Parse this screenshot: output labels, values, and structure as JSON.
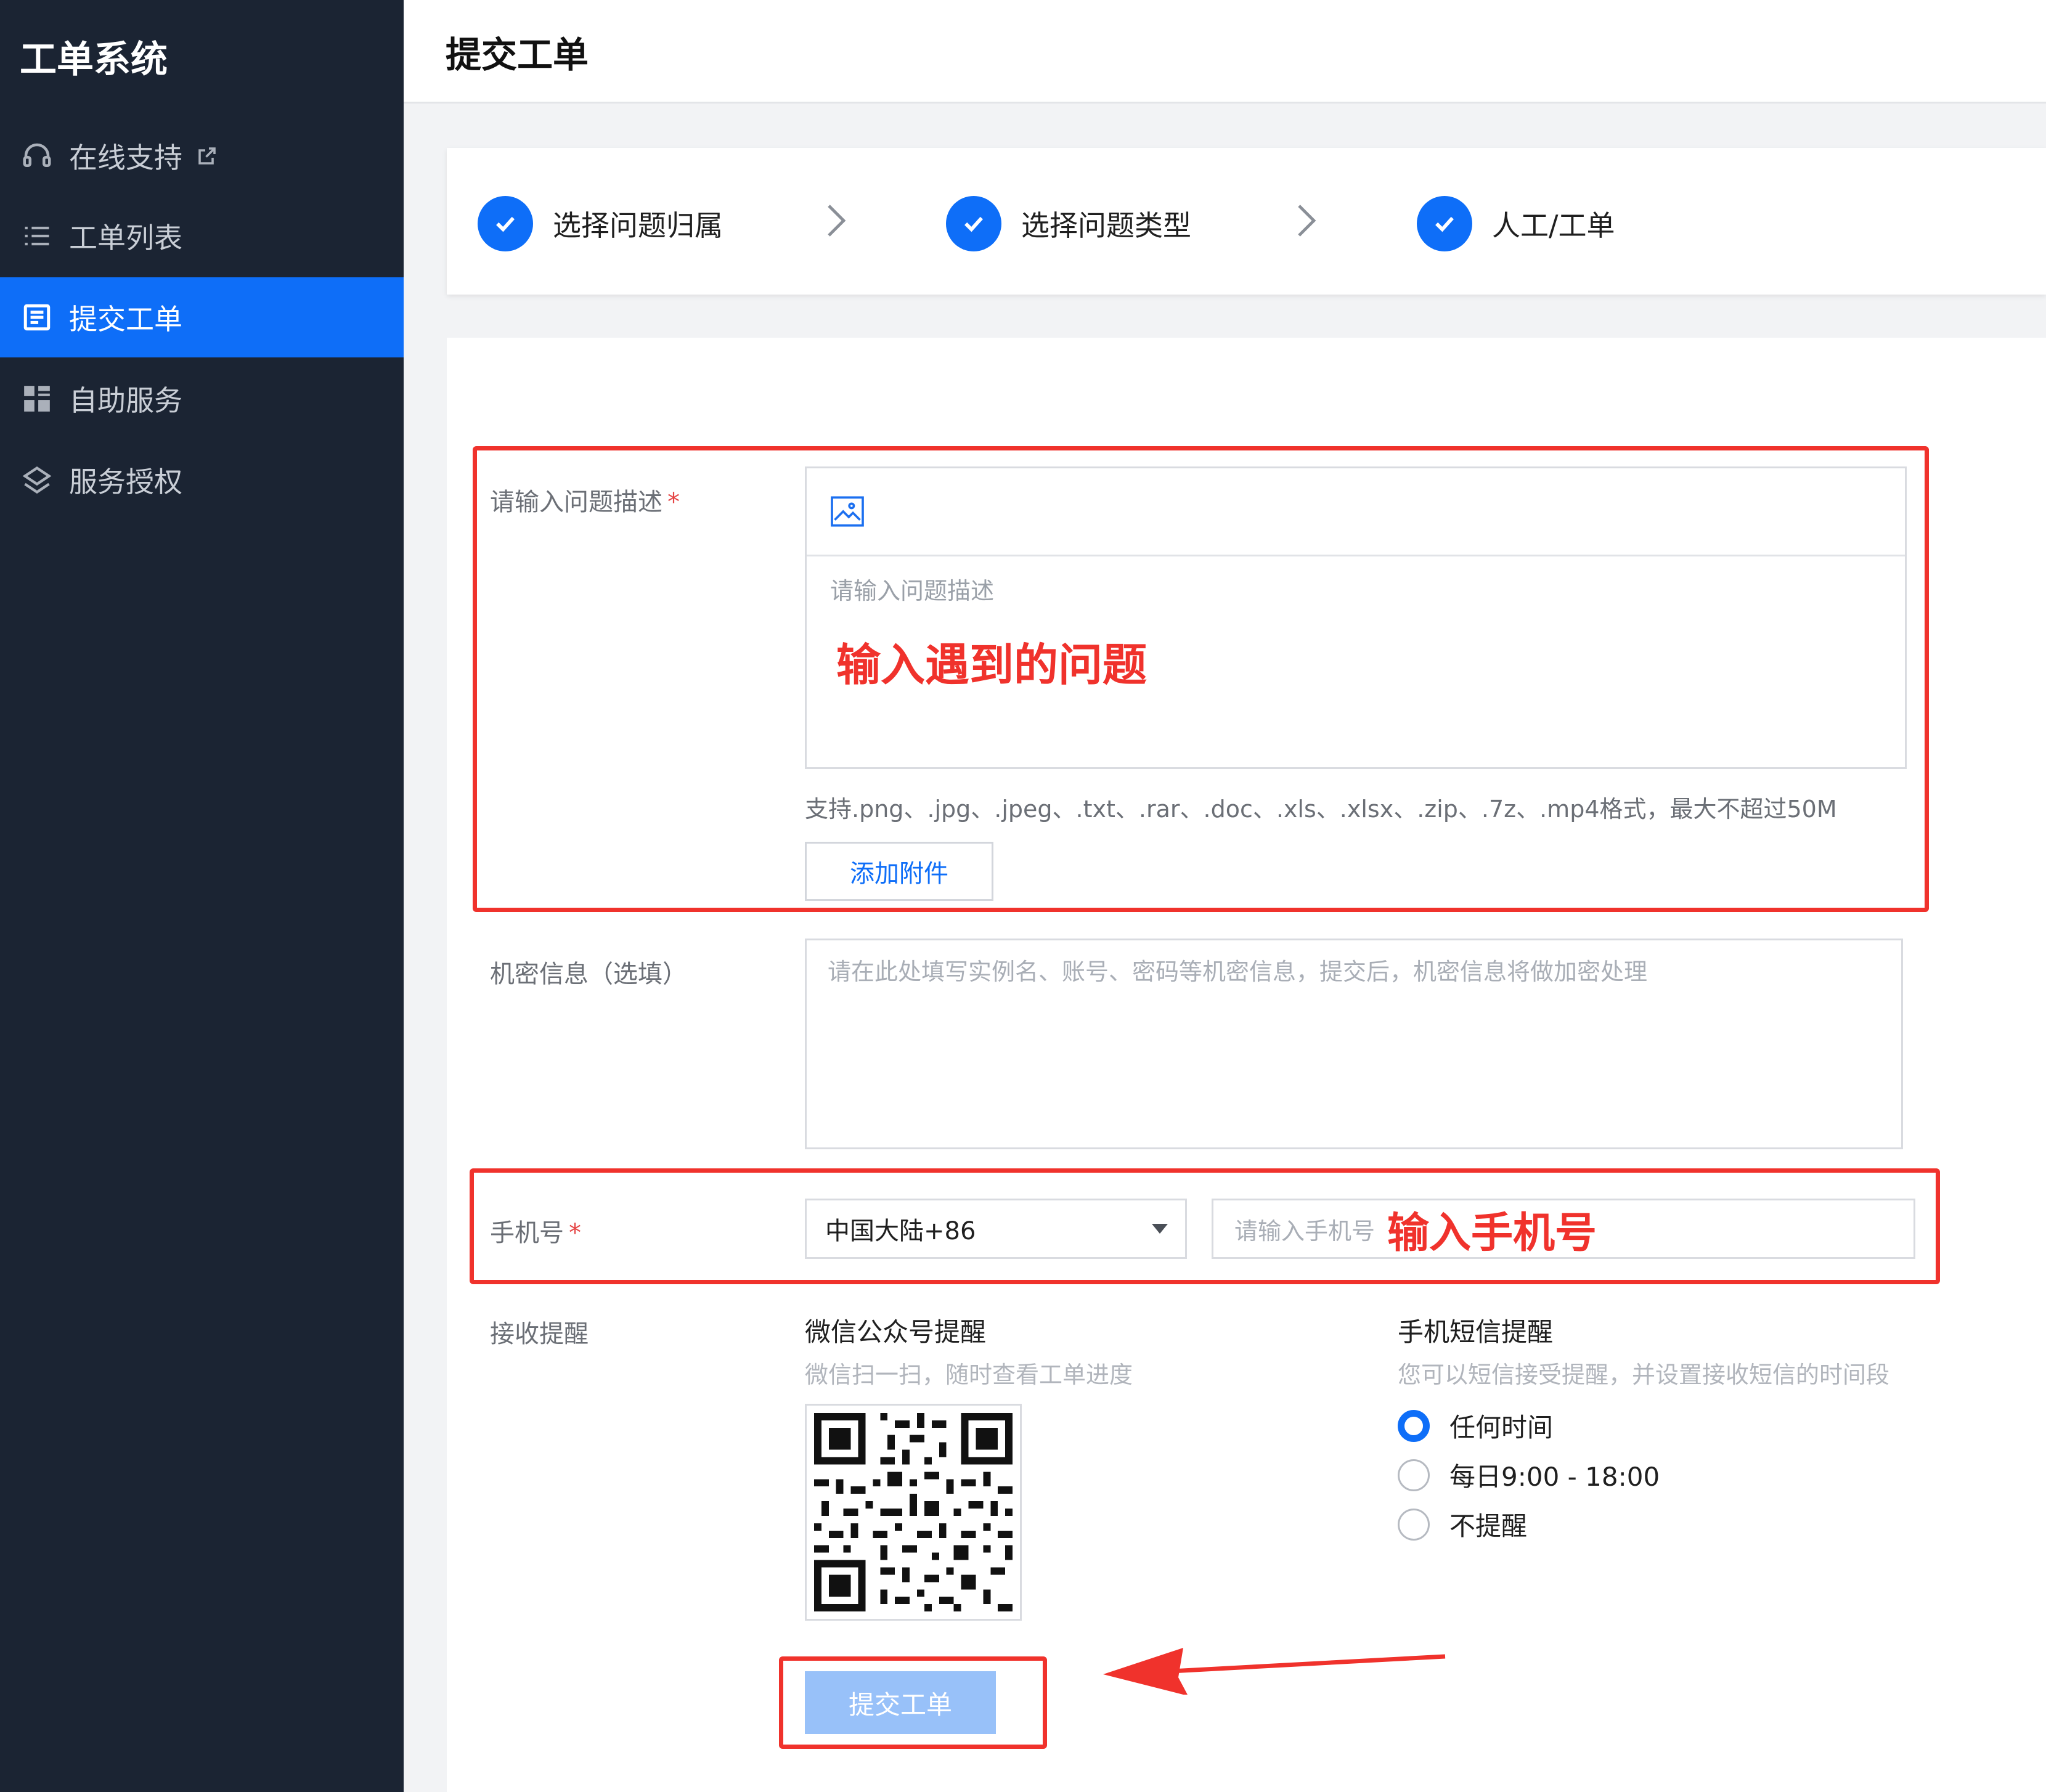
{
  "app": {
    "brand": "工单系统",
    "page_title": "提交工单"
  },
  "sidebar": {
    "items": [
      {
        "label": "在线支持",
        "icon": "headset-icon",
        "external": true,
        "active": false
      },
      {
        "label": "工单列表",
        "icon": "list-icon",
        "active": false
      },
      {
        "label": "提交工单",
        "icon": "form-icon",
        "active": true
      },
      {
        "label": "自助服务",
        "icon": "grid-icon",
        "active": false
      },
      {
        "label": "服务授权",
        "icon": "layers-icon",
        "active": false
      }
    ]
  },
  "steps": [
    {
      "label": "选择问题归属",
      "done": true
    },
    {
      "label": "选择问题类型",
      "done": true
    },
    {
      "label": "人工/工单",
      "done": true
    }
  ],
  "form": {
    "description": {
      "label": "请输入问题描述",
      "required_mark": "*",
      "placeholder": "请输入问题描述",
      "annotation": "输入遇到的问题"
    },
    "attachment": {
      "hint": "支持.png、.jpg、.jpeg、.txt、.rar、.doc、.xls、.xlsx、.zip、.7z、.mp4格式，最大不超过50M",
      "button_label": "添加附件"
    },
    "secret": {
      "label": "机密信息（选填）",
      "placeholder": "请在此处填写实例名、账号、密码等机密信息，提交后，机密信息将做加密处理"
    },
    "phone": {
      "label": "手机号",
      "required_mark": "*",
      "region_value": "中国大陆+86",
      "placeholder": "请输入手机号",
      "annotation": "输入手机号"
    },
    "notify": {
      "label": "接收提醒",
      "wechat": {
        "title": "微信公众号提醒",
        "subtitle": "微信扫一扫，随时查看工单进度"
      },
      "sms": {
        "title": "手机短信提醒",
        "subtitle": "您可以短信接受提醒，并设置接收短信的时间段",
        "options": [
          {
            "label": "任何时间",
            "checked": true
          },
          {
            "label": "每日9:00 - 18:00",
            "checked": false
          },
          {
            "label": "不提醒",
            "checked": false
          }
        ]
      }
    },
    "submit_label": "提交工单"
  },
  "colors": {
    "sidebar_bg": "#1b2433",
    "accent": "#0e6ef8",
    "annotation_red": "#f0322c",
    "submit_disabled": "#98c1f9"
  }
}
